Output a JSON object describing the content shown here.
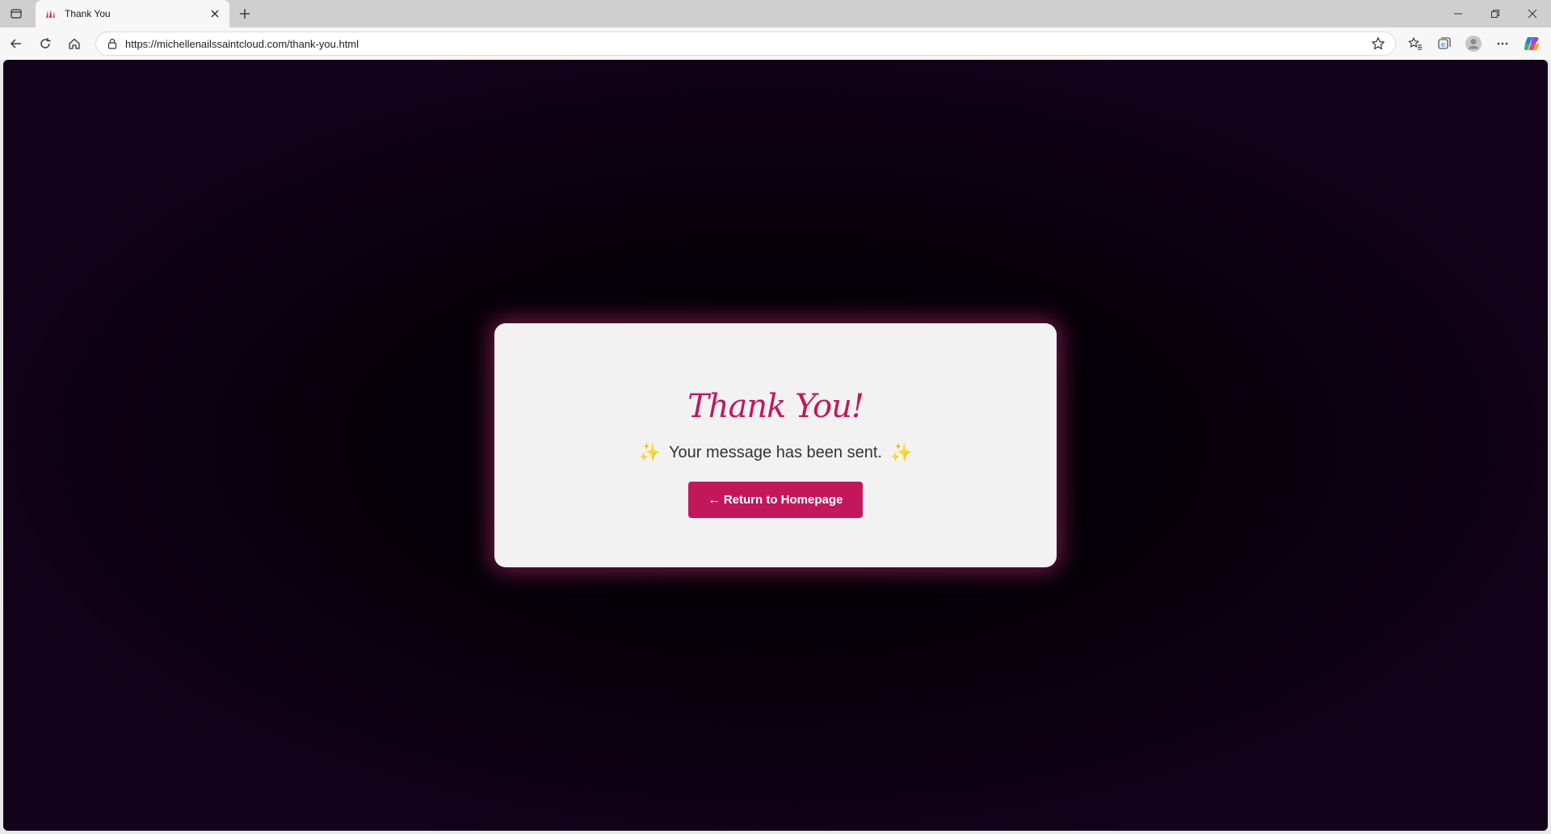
{
  "browser": {
    "tab": {
      "title": "Thank You"
    },
    "address": {
      "url": "https://michellenailssaintcloud.com/thank-you.html"
    }
  },
  "page": {
    "title": "Thank You!",
    "message": "Your message has been sent.",
    "sparkle_left": "✨",
    "sparkle_right": "✨",
    "button_label": "← Return to Homepage"
  },
  "colors": {
    "accent": "#c2185b",
    "card_bg": "#f2f2f2",
    "page_bg": "#000000",
    "sparkle": "#f3b23c"
  },
  "icons": {
    "tab_actions": "tab-actions-icon",
    "favicon": "nails-favicon",
    "close": "close-icon",
    "new_tab": "plus-icon",
    "back": "back-arrow-icon",
    "reload": "reload-icon",
    "home": "home-icon",
    "lock": "lock-icon",
    "favorite": "star-icon",
    "favorites": "favorites-icon",
    "collections": "collections-icon",
    "profile": "profile-icon",
    "more": "more-icon",
    "copilot": "copilot-icon"
  }
}
